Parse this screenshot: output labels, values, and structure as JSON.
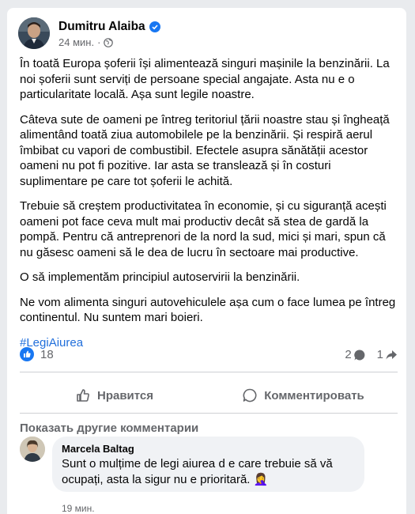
{
  "post": {
    "author": "Dumitru Alaiba",
    "time": "24 мин.",
    "paragraphs": [
      "În toată Europa șoferii își alimentează singuri mașinile la benzinării. La noi șoferii sunt serviți de persoane special angajate. Asta nu e o particularitate locală. Așa sunt legile noastre.",
      "Câteva sute de oameni pe întreg teritoriul țării noastre stau și îngheață alimentând toată ziua automobilele pe la benzinării. Și respiră aerul îmbibat cu vapori de combustibil. Efectele asupra sănătății acestor oameni nu pot fi pozitive. Iar asta se translează și în costuri suplimentare pe care tot șoferii le achită.",
      "Trebuie să creștem productivitatea în economie, și cu siguranță acești oameni pot face ceva mult mai productiv decât să stea de gardă la pompă. Pentru că antreprenori de la nord la sud, mici și mari, spun că nu găsesc oameni să le dea de lucru în sectoare mai productive.",
      "O să implementăm principiul autoservirii la benzinării.",
      "Ne vom alimenta singuri autovehiculele așa cum o face lumea pe întreg continentul. Nu suntem mari boieri."
    ],
    "hashtag": "#LegiAiurea"
  },
  "stats": {
    "reactions": "18",
    "comments": "2",
    "shares": "1"
  },
  "actions": {
    "like": "Нравится",
    "comment": "Комментировать"
  },
  "comments_section": {
    "more_label": "Показать другие комментарии",
    "items": [
      {
        "name": "Marcela Baltag",
        "text": "Sunt o mulțime de legi aiurea d e care trebuie să vă ocupați, asta la sigur nu e prioritară.",
        "emoji": "🤦‍♀️",
        "time": "19 мин."
      }
    ]
  },
  "colors": {
    "accent": "#1877f2",
    "link": "#216fdb",
    "muted": "#65676b"
  }
}
